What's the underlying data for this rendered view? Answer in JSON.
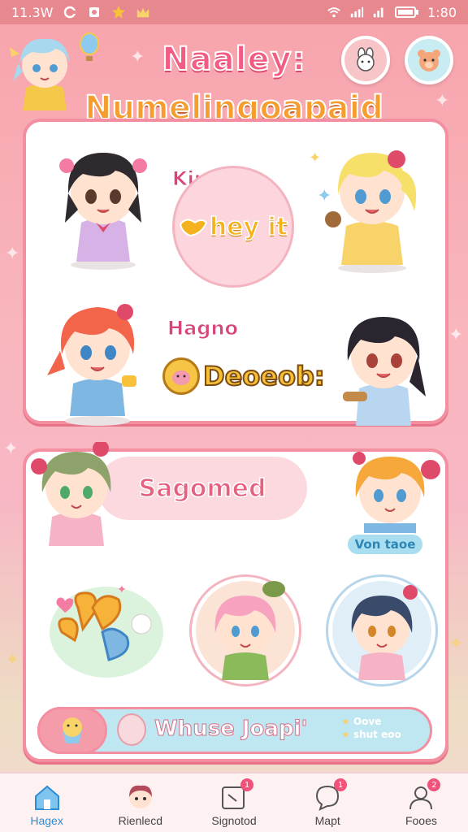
{
  "status_bar": {
    "time": "11.3W",
    "clock_right": "1:80",
    "icons": [
      "signal-icon",
      "wifi-icon",
      "battery-icon"
    ]
  },
  "header": {
    "title_line1": "Naaley:",
    "title_line2": "Numelingoapaid"
  },
  "card1": {
    "label_top": "Kimh",
    "bubble_text": "hey it",
    "label_bottom": "Hagno",
    "coin_text": "Deoeob:"
  },
  "card2": {
    "banner": "Sagomed",
    "mini_badge": "Von taoe",
    "strip_text": "Whuse Joapi'",
    "strip_right_line1": "Oove",
    "strip_right_line2": "shut eoo"
  },
  "tabbar": {
    "tabs": [
      {
        "label": "Hagex",
        "icon": "home-icon",
        "active": true
      },
      {
        "label": "Rienlecd",
        "icon": "avatar-icon",
        "active": false
      },
      {
        "label": "Signotod",
        "icon": "edit-icon",
        "active": false,
        "badge": "1"
      },
      {
        "label": "Mapt",
        "icon": "chat-icon",
        "active": false,
        "badge": "1"
      },
      {
        "label": "Fooes",
        "icon": "profile-icon",
        "active": false,
        "badge": "2"
      }
    ]
  },
  "colors": {
    "accent_pink": "#f38fa0",
    "title_pink": "#f35c82",
    "title_orange": "#f59d2f",
    "tab_active": "#2c8ed4"
  }
}
